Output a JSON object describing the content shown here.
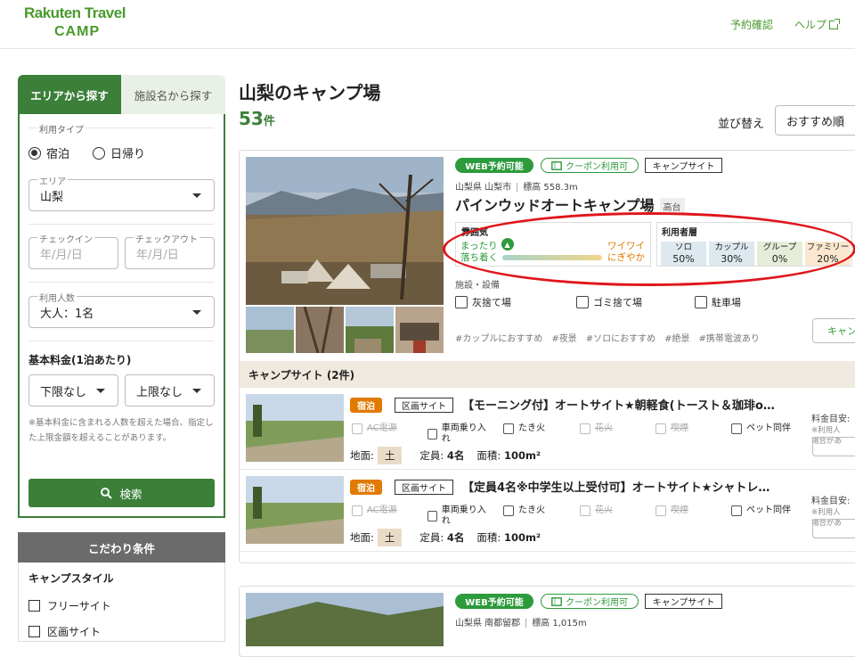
{
  "header": {
    "logo_line1": "Rakuten Travel",
    "logo_line2": "CAMP",
    "reservation_link": "予約確認",
    "help_link": "ヘルプ"
  },
  "sidebar": {
    "tab_area": "エリアから探す",
    "tab_facility": "施設名から探す",
    "usage_type_label": "利用タイプ",
    "radio_stay": "宿泊",
    "radio_day": "日帰り",
    "area_label": "エリア",
    "area_value": "山梨",
    "checkin_label": "チェックイン",
    "checkin_placeholder": "年/月/日",
    "checkout_label": "チェックアウト",
    "checkout_placeholder": "年/月/日",
    "guests_label": "利用人数",
    "guests_value": "大人：1名",
    "price_label": "基本料金(1泊あたり)",
    "price_min": "下限なし",
    "price_max": "上限なし",
    "note": "※基本料金に含まれる人数を超えた場合、指定した上限金額を超えることがあります。",
    "search_button": "検索",
    "kodawari_title": "こだわり条件",
    "camp_style_label": "キャンプスタイル",
    "check_free_site": "フリーサイト",
    "check_kukaku_site": "区画サイト"
  },
  "main": {
    "title": "山梨のキャンプ場",
    "count": "53",
    "count_unit": "件",
    "sort_label": "並び替え",
    "sort_value": "おすすめ順"
  },
  "card1": {
    "badge_web": "WEB予約可能",
    "badge_coupon": "クーポン利用可",
    "badge_site": "キャンプサイト",
    "location": "山梨県 山梨市",
    "altitude": "標高 558.3m",
    "name": "パインウッドオートキャンプ場",
    "terrain_tag": "高台",
    "atmosphere_title": "雰囲気",
    "atmosphere_left_1": "まったり",
    "atmosphere_left_2": "落ち着く",
    "atmosphere_right_1": "ワイワイ",
    "atmosphere_right_2": "にぎやか",
    "atmosphere_level": 0.05,
    "users_title": "利用者層",
    "users": [
      {
        "label": "ソロ",
        "value": "50%",
        "color": "#dde8ef"
      },
      {
        "label": "カップル",
        "value": "30%",
        "color": "#dde8ef"
      },
      {
        "label": "グループ",
        "value": "0%",
        "color": "#e5ecd8"
      },
      {
        "label": "ファミリー",
        "value": "20%",
        "color": "#fbe7cf"
      }
    ],
    "facilities_title": "施設・設備",
    "facilities": [
      "灰捨て場",
      "ゴミ捨て場",
      "駐車場"
    ],
    "tags": "#カップルにおすすめ　#夜景　#ソロにおすすめ　#絶景　#携帯電波あり",
    "button_partial": "キャン",
    "site_header": "キャンプサイト (2件)"
  },
  "sites": [
    {
      "stay": "宿泊",
      "type": "区画サイト",
      "name": "【モーニング付】オートサイト★朝軽食(トースト＆珈琲o…",
      "features": [
        {
          "label": "AC電源",
          "available": false
        },
        {
          "label": "車両乗り入れ",
          "available": true
        },
        {
          "label": "たき火",
          "available": true
        },
        {
          "label": "花火",
          "available": false
        },
        {
          "label": "喫煙",
          "available": false
        },
        {
          "label": "ペット同伴",
          "available": true
        }
      ],
      "ground_label": "地面:",
      "ground_value": "土",
      "capacity_label": "定員:",
      "capacity_value": "4名",
      "area_label": "面積:",
      "area_value": "100m²",
      "price_label": "料金目安:",
      "price_note_1": "※利用人",
      "price_note_2": "場合があ"
    },
    {
      "stay": "宿泊",
      "type": "区画サイト",
      "name": "【定員4名※中学生以上受付可】オートサイト★シャトレ…",
      "features": [
        {
          "label": "AC電源",
          "available": false
        },
        {
          "label": "車両乗り入れ",
          "available": true
        },
        {
          "label": "たき火",
          "available": true
        },
        {
          "label": "花火",
          "available": false
        },
        {
          "label": "喫煙",
          "available": false
        },
        {
          "label": "ペット同伴",
          "available": true
        }
      ],
      "ground_label": "地面:",
      "ground_value": "土",
      "capacity_label": "定員:",
      "capacity_value": "4名",
      "area_label": "面積:",
      "area_value": "100m²",
      "price_label": "料金目安:",
      "price_note_1": "※利用人",
      "price_note_2": "場合があ"
    }
  ],
  "card2": {
    "badge_web": "WEB予約可能",
    "badge_coupon": "クーポン利用可",
    "badge_site": "キャンプサイト",
    "location": "山梨県 南都留郡",
    "altitude": "標高 1,015m"
  },
  "colors": {
    "brand_green": "#3b7f39",
    "badge_green": "#2d9b3c",
    "stay_orange": "#e07b00",
    "highlight_red": "#e0151a"
  }
}
